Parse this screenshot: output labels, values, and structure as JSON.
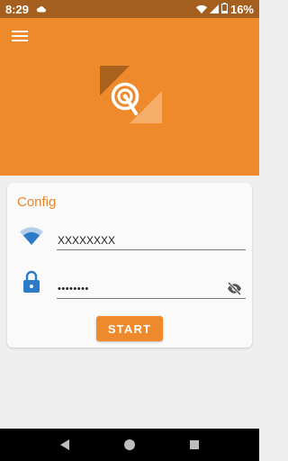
{
  "status": {
    "time": "8:29",
    "battery": "16%",
    "icons": [
      "cloud-icon",
      "wifi-icon",
      "signal-icon",
      "battery-icon"
    ]
  },
  "header": {
    "menu_icon": "hamburger-menu-icon",
    "logo_icon": "broadcast-logo-icon"
  },
  "config": {
    "title": "Config",
    "ssid": {
      "icon": "wifi-icon",
      "value": "XXXXXXXX"
    },
    "password": {
      "icon": "lock-icon",
      "value": "••••••••",
      "toggle_icon": "eye-off-icon"
    },
    "start_label": "START"
  },
  "nav": {
    "icons": [
      "back-icon",
      "home-icon",
      "recents-icon"
    ]
  },
  "colors": {
    "primary": "#ee8a2b",
    "primary_dark": "#a45f1e",
    "background": "#eeeeee",
    "card": "#fafafa"
  }
}
